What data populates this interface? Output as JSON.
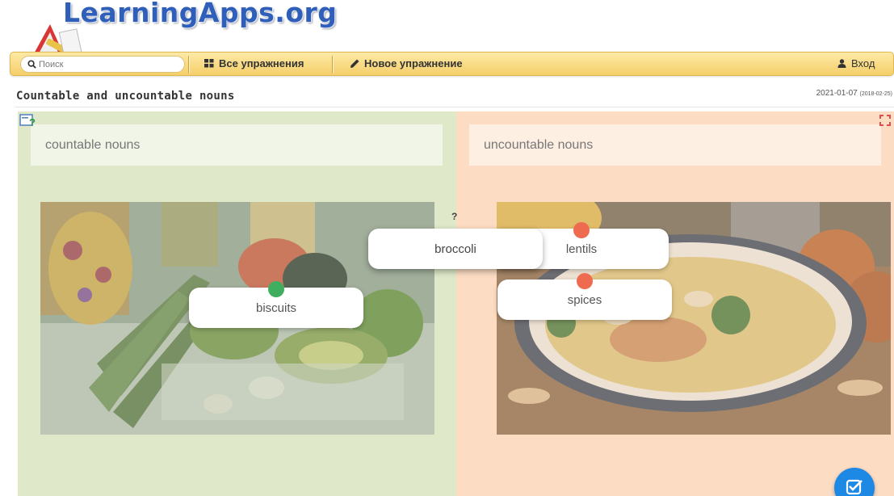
{
  "header": {
    "logo_text": "LearningApps.org"
  },
  "toolbar": {
    "search_placeholder": "Поиск",
    "all_exercises_label": "Все упражнения",
    "new_exercise_label": "Новое упражнение",
    "login_label": "Вход"
  },
  "page": {
    "title": "Countable and uncountable nouns",
    "date": "2021-01-07",
    "date_created": "(2018-02-25)"
  },
  "exercise": {
    "categories": [
      {
        "label": "countable nouns"
      },
      {
        "label": "uncountable nouns"
      }
    ],
    "cards": [
      {
        "label": "broccoli",
        "status": "unplaced",
        "marker": "?"
      },
      {
        "label": "lentils",
        "status": "incorrect"
      },
      {
        "label": "biscuits",
        "status": "correct"
      },
      {
        "label": "spices",
        "status": "incorrect"
      }
    ]
  },
  "icons": {
    "search": "search-icon",
    "grid": "grid-icon",
    "pencil": "pencil-icon",
    "user": "user-icon",
    "help": "help-icon",
    "fullscreen": "fullscreen-icon",
    "check": "check-icon"
  },
  "colors": {
    "toolbar": "#f5cf6a",
    "left_pane": "#dfe8c9",
    "right_pane": "#fcdcc2",
    "correct": "#3fae5f",
    "incorrect": "#ef6b4f",
    "check_button": "#1e88e5",
    "logo": "#2f5fb8"
  }
}
